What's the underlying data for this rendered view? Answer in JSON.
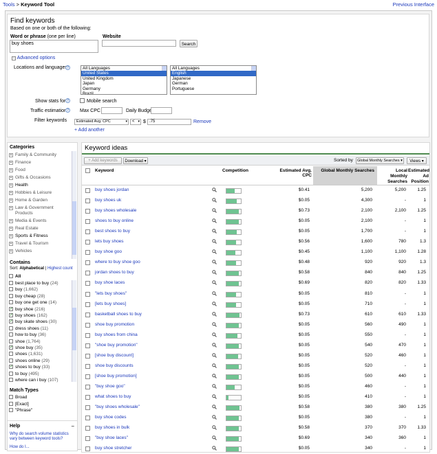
{
  "topbar": {
    "tools": "Tools",
    "sep": ">",
    "title": "Keyword Tool",
    "previous": "Previous Interface"
  },
  "find": {
    "title": "Find keywords",
    "subtitle": "Based on one or both of the following:",
    "word_label": "Word or phrase",
    "word_hint": "(one per line)",
    "word_value": "buy shoes",
    "website_label": "Website",
    "search_button": "Search",
    "advanced": "Advanced options",
    "loc_label": "Locations and languages",
    "locations": [
      "All Languages",
      "United States",
      "United Kingdom",
      "Japan",
      "Germany",
      "Brazil"
    ],
    "languages": [
      "All Languages",
      "English",
      "Japanese",
      "German",
      "Portuguese"
    ],
    "show_stats_label": "Show stats for",
    "mobile_search": "Mobile search",
    "traffic_label": "Traffic estimation",
    "max_cpc_label": "Max CPC $",
    "daily_budget_label": "Daily Budget $",
    "filter_label": "Filter keywords",
    "filter_field": "Estimated Avg. CPC",
    "filter_op": "<",
    "filter_currency": "$",
    "filter_value": ".75",
    "remove": "Remove",
    "add_another": "+ Add another"
  },
  "categories": {
    "title": "Categories",
    "items": [
      {
        "label": "Family & Community",
        "bold": false
      },
      {
        "label": "Finance",
        "bold": false
      },
      {
        "label": "Food",
        "bold": false
      },
      {
        "label": "Gifts & Occasions",
        "bold": false
      },
      {
        "label": "Health",
        "bold": true
      },
      {
        "label": "Hobbies & Leisure",
        "bold": false
      },
      {
        "label": "Home & Garden",
        "bold": false
      },
      {
        "label": "Law & Government",
        "bold": false
      },
      {
        "label": "Products",
        "bold": false
      },
      {
        "label": "Media & Events",
        "bold": false
      },
      {
        "label": "Real Estate",
        "bold": false
      },
      {
        "label": "Sports & Fitness",
        "bold": true
      },
      {
        "label": "Travel & Tourism",
        "bold": false
      },
      {
        "label": "Vehicles",
        "bold": false
      }
    ]
  },
  "contains": {
    "title": "Contains",
    "sort_label": "Sort:",
    "sort_alpha": "Alphabetical",
    "sort_sep": "|",
    "sort_count": "Highest count",
    "all": "All",
    "items": [
      {
        "label": "best place to buy",
        "count": "(24)",
        "checked": false
      },
      {
        "label": "buy",
        "count": "(1,662)",
        "checked": false
      },
      {
        "label": "buy cheap",
        "count": "(28)",
        "checked": false
      },
      {
        "label": "buy one get one",
        "count": "(14)",
        "checked": false
      },
      {
        "label": "buy shoe",
        "count": "(216)",
        "checked": true
      },
      {
        "label": "buy shoes",
        "count": "(162)",
        "checked": true
      },
      {
        "label": "buy skate shoes",
        "count": "(30)",
        "checked": true
      },
      {
        "label": "dress shoes",
        "count": "(11)",
        "checked": false
      },
      {
        "label": "how to buy",
        "count": "(36)",
        "checked": false
      },
      {
        "label": "shoe",
        "count": "(1,764)",
        "checked": false
      },
      {
        "label": "shoe buy",
        "count": "(35)",
        "checked": true
      },
      {
        "label": "shoes",
        "count": "(1,631)",
        "checked": false
      },
      {
        "label": "shoes online",
        "count": "(29)",
        "checked": false
      },
      {
        "label": "shoes to buy",
        "count": "(33)",
        "checked": true
      },
      {
        "label": "to buy",
        "count": "(495)",
        "checked": false
      },
      {
        "label": "where can i buy",
        "count": "(107)",
        "checked": false
      }
    ]
  },
  "match_types": {
    "title": "Match Types",
    "items": [
      "Broad",
      "[Exact]",
      "\"Phrase\""
    ]
  },
  "help": {
    "title": "Help",
    "link": "Why do search volume statistics vary between keyword tools?",
    "link2": "How do I..."
  },
  "ideas": {
    "title": "Keyword ideas",
    "add_keywords": "+ Add keywords",
    "download": "Download",
    "sorted_by": "Sorted by",
    "sorted_value": "Global Monthly Searches",
    "views": "Views",
    "columns": {
      "keyword": "Keyword",
      "competition": "Competition",
      "cpc": "Estimated Avg. CPC",
      "global": "Global Monthly Searches",
      "local": "Local Monthly Searches",
      "position": "Estimated Ad Position"
    },
    "rows": [
      {
        "kw": "buy shoes jordan",
        "comp": 0.55,
        "cpc": "$0.41",
        "gms": "5,200",
        "lms": "5,200",
        "pos": "1.25"
      },
      {
        "kw": "buy shoes uk",
        "comp": 0.7,
        "cpc": "$0.05",
        "gms": "4,300",
        "lms": "-",
        "pos": "1"
      },
      {
        "kw": "buy shoes wholesale",
        "comp": 0.85,
        "cpc": "$0.73",
        "gms": "2,100",
        "lms": "2,100",
        "pos": "1.25"
      },
      {
        "kw": "shoes to buy online",
        "comp": 0.85,
        "cpc": "$0.05",
        "gms": "2,100",
        "lms": "-",
        "pos": "1"
      },
      {
        "kw": "best shoes to buy",
        "comp": 0.7,
        "cpc": "$0.05",
        "gms": "1,700",
        "lms": "-",
        "pos": "1"
      },
      {
        "kw": "lets buy shoes",
        "comp": 0.65,
        "cpc": "$0.56",
        "gms": "1,600",
        "lms": "780",
        "pos": "1.3"
      },
      {
        "kw": "buy shoe goo",
        "comp": 0.6,
        "cpc": "$0.45",
        "gms": "1,100",
        "lms": "1,100",
        "pos": "1.28"
      },
      {
        "kw": "where to buy shoe goo",
        "comp": 0.65,
        "cpc": "$0.48",
        "gms": "920",
        "lms": "920",
        "pos": "1.3"
      },
      {
        "kw": "jordan shoes to buy",
        "comp": 0.85,
        "cpc": "$0.58",
        "gms": "840",
        "lms": "840",
        "pos": "1.25"
      },
      {
        "kw": "buy shoe laces",
        "comp": 0.85,
        "cpc": "$0.69",
        "gms": "820",
        "lms": "820",
        "pos": "1.33"
      },
      {
        "kw": "\"lets buy shoes\"",
        "comp": 0.65,
        "cpc": "$0.05",
        "gms": "810",
        "lms": "-",
        "pos": "1"
      },
      {
        "kw": "[lets buy shoes]",
        "comp": 0.65,
        "cpc": "$0.05",
        "gms": "710",
        "lms": "-",
        "pos": "1"
      },
      {
        "kw": "basketball shoes to buy",
        "comp": 0.9,
        "cpc": "$0.73",
        "gms": "610",
        "lms": "610",
        "pos": "1.33"
      },
      {
        "kw": "shoe buy promotion",
        "comp": 0.85,
        "cpc": "$0.05",
        "gms": "560",
        "lms": "490",
        "pos": "1"
      },
      {
        "kw": "buy shoes from china",
        "comp": 0.75,
        "cpc": "$0.05",
        "gms": "550",
        "lms": "-",
        "pos": "1"
      },
      {
        "kw": "\"shoe buy promotion\"",
        "comp": 0.85,
        "cpc": "$0.05",
        "gms": "540",
        "lms": "470",
        "pos": "1"
      },
      {
        "kw": "[shoe buy discount]",
        "comp": 0.8,
        "cpc": "$0.05",
        "gms": "520",
        "lms": "460",
        "pos": "1"
      },
      {
        "kw": "shoe buy discounts",
        "comp": 0.85,
        "cpc": "$0.05",
        "gms": "520",
        "lms": "-",
        "pos": "1"
      },
      {
        "kw": "[shoe buy promotion]",
        "comp": 0.85,
        "cpc": "$0.05",
        "gms": "500",
        "lms": "440",
        "pos": "1"
      },
      {
        "kw": "\"buy shoe goo\"",
        "comp": 0.55,
        "cpc": "$0.05",
        "gms": "460",
        "lms": "-",
        "pos": "1"
      },
      {
        "kw": "what shoes to buy",
        "comp": 0.15,
        "cpc": "$0.05",
        "gms": "410",
        "lms": "-",
        "pos": "1"
      },
      {
        "kw": "\"buy shoes wholesale\"",
        "comp": 0.9,
        "cpc": "$0.58",
        "gms": "380",
        "lms": "380",
        "pos": "1.25"
      },
      {
        "kw": "buy shoe codes",
        "comp": 0.85,
        "cpc": "$0.05",
        "gms": "380",
        "lms": "-",
        "pos": "1"
      },
      {
        "kw": "buy shoes in bulk",
        "comp": 0.85,
        "cpc": "$0.58",
        "gms": "370",
        "lms": "370",
        "pos": "1.33"
      },
      {
        "kw": "\"buy shoe laces\"",
        "comp": 0.85,
        "cpc": "$0.69",
        "gms": "340",
        "lms": "360",
        "pos": "1"
      },
      {
        "kw": "buy shoe stretcher",
        "comp": 0.85,
        "cpc": "$0.05",
        "gms": "340",
        "lms": "-",
        "pos": "1"
      }
    ]
  }
}
